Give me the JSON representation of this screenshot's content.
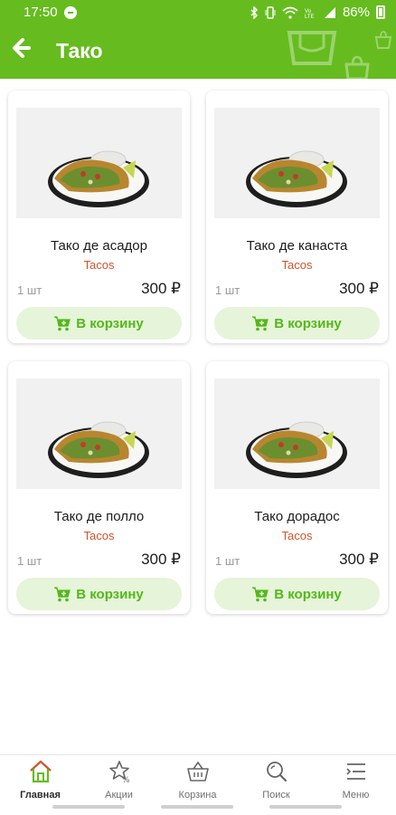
{
  "status_bar": {
    "time": "17:50",
    "battery": "86%",
    "icons": [
      "do-not-disturb-icon",
      "bluetooth-icon",
      "vibrate-icon",
      "wifi-icon",
      "volte-icon",
      "signal-icon",
      "battery-icon"
    ]
  },
  "header": {
    "title": "Тако",
    "back_icon": "back-arrow-icon",
    "background_color": "#66bc1f"
  },
  "products": [
    {
      "name": "Тако де асадор",
      "category": "Tacos",
      "quantity": "1 шт",
      "price": "300 ₽",
      "button_label": "В корзину"
    },
    {
      "name": "Тако де канаста",
      "category": "Tacos",
      "quantity": "1 шт",
      "price": "300 ₽",
      "button_label": "В корзину"
    },
    {
      "name": "Тако де полло",
      "category": "Tacos",
      "quantity": "1 шт",
      "price": "300 ₽",
      "button_label": "В корзину"
    },
    {
      "name": "Тако дорадос",
      "category": "Tacos",
      "quantity": "1 шт",
      "price": "300 ₽",
      "button_label": "В корзину"
    }
  ],
  "bottom_nav": {
    "items": [
      {
        "label": "Главная",
        "icon": "home-icon",
        "active": true
      },
      {
        "label": "Акции",
        "icon": "star-percent-icon",
        "active": false
      },
      {
        "label": "Корзина",
        "icon": "basket-icon",
        "active": false
      },
      {
        "label": "Поиск",
        "icon": "search-icon",
        "active": false
      },
      {
        "label": "Меню",
        "icon": "menu-icon",
        "active": false
      }
    ]
  },
  "colors": {
    "accent": "#66bc1f",
    "button_bg": "#e6f4d9",
    "button_text": "#53b81a",
    "category_text": "#d0542b",
    "home_icon": "#d0542b"
  }
}
